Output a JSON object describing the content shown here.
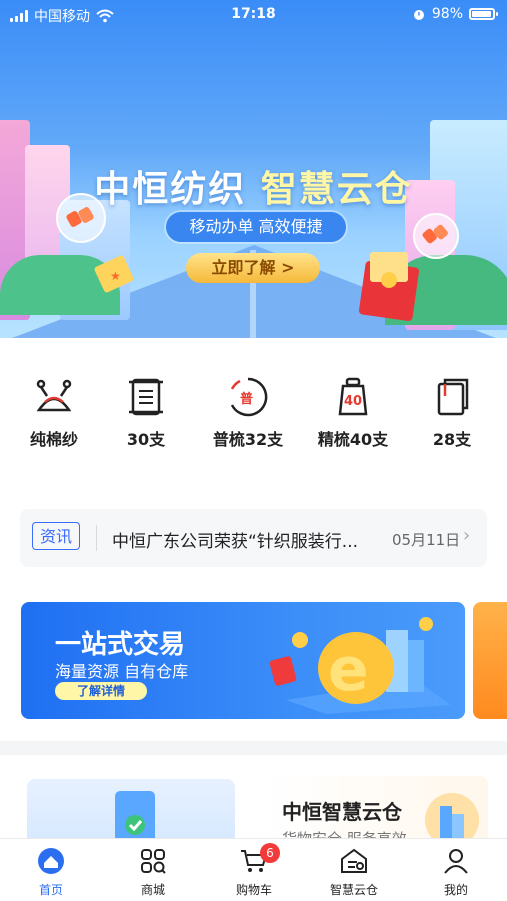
{
  "status_bar": {
    "carrier": "中国移动",
    "time": "17:18",
    "battery": "98%"
  },
  "banner": {
    "title_main": "中恒纺织",
    "title_highlight": "智慧云仓",
    "subtitle": "移动办单 高效便捷",
    "button": "立即了解 >"
  },
  "categories": [
    {
      "label": "纯棉纱",
      "icon": "yarn-cone-icon"
    },
    {
      "label": "30支",
      "icon": "scroll-icon"
    },
    {
      "label": "普梳32支",
      "icon": "circle-badge-icon",
      "badge": "普"
    },
    {
      "label": "精梳40支",
      "icon": "weight-icon",
      "badge": "40"
    },
    {
      "label": "28支",
      "icon": "roll-icon"
    }
  ],
  "news": {
    "tag": "资讯",
    "text": "中恒广东公司荣获“针织服装行...",
    "date": "05月11日"
  },
  "promo": {
    "title": "一站式交易",
    "subtitle": "海量资源 自有仓库",
    "button": "了解详情"
  },
  "card_right": {
    "title": "中恒智慧云仓",
    "subtitle": "货物安全 服务高效"
  },
  "tabbar": {
    "items": [
      {
        "label": "首页",
        "icon": "home-icon",
        "active": true
      },
      {
        "label": "商城",
        "icon": "grid-icon"
      },
      {
        "label": "购物车",
        "icon": "cart-icon",
        "badge": "6"
      },
      {
        "label": "智慧云仓",
        "icon": "warehouse-icon"
      },
      {
        "label": "我的",
        "icon": "user-icon"
      }
    ]
  },
  "colors": {
    "accent": "#2b6ff0",
    "promo_blue": "#1f6ff3",
    "badge_red": "#f23a3a",
    "highlight_yellow": "#fff7a6"
  }
}
